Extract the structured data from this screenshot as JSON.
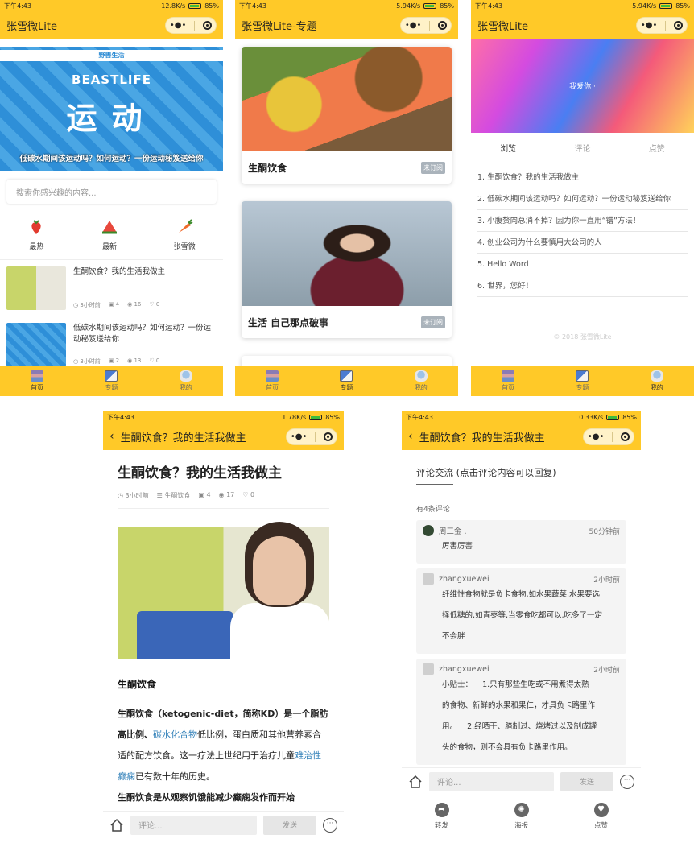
{
  "status": {
    "p1": {
      "time": "下午4:43",
      "speed": "12.8K/s",
      "battery": "85%"
    },
    "p2": {
      "time": "下午4:43",
      "speed": "5.94K/s",
      "battery": "85%"
    },
    "p3": {
      "time": "下午4:43",
      "speed": "5.94K/s",
      "battery": "85%"
    },
    "p4": {
      "time": "下午4:43",
      "speed": "1.78K/s",
      "battery": "85%"
    },
    "p5": {
      "time": "下午4:43",
      "speed": "0.33K/s",
      "battery": "85%"
    }
  },
  "capsule": {
    "dots": "•●•"
  },
  "home": {
    "title": "张雪微Lite",
    "banner": {
      "tag": "野兽生活",
      "brand": "BEASTLIFE",
      "big": "运动",
      "caption": "低碳水期间该运动吗？如何运动？一份运动秘笈送给你"
    },
    "search_placeholder": "搜索你感兴趣的内容...",
    "categories": [
      {
        "label": "最热",
        "icon": "strawberry-icon"
      },
      {
        "label": "最新",
        "icon": "watermelon-icon"
      },
      {
        "label": "张雪微",
        "icon": "carrot-icon"
      }
    ],
    "posts": [
      {
        "title": "生酮饮食？我的生活我做主",
        "time": "3小时前",
        "comments": "4",
        "views": "16",
        "likes": "0"
      },
      {
        "title": "低碳水期间该运动吗？如何运动？一份运动秘笈送给你",
        "time": "3小时前",
        "comments": "2",
        "views": "13",
        "likes": "0"
      }
    ]
  },
  "tabbar": [
    {
      "label": "首页",
      "icon": "home-tab-icon"
    },
    {
      "label": "专题",
      "icon": "topic-tab-icon"
    },
    {
      "label": "我的",
      "icon": "mine-tab-icon"
    }
  ],
  "topics": {
    "title": "张雪微Lite-专题",
    "cards": [
      {
        "title": "生酮饮食",
        "badge": "未订阅"
      },
      {
        "title": "生活 自己那点破事",
        "badge": "未订阅"
      }
    ]
  },
  "mine": {
    "title": "张雪微Lite",
    "hero_text": "我爱你 ·",
    "tabs": [
      "浏览",
      "评论",
      "点赞"
    ],
    "list": [
      "1. 生酮饮食？我的生活我做主",
      "2. 低碳水期间该运动吗？如何运动？一份运动秘笈送给你",
      "3. 小腹赘肉总消不掉？因为你一直用“错”方法！",
      "4. 创业公司为什么要慎用大公司的人",
      "5. Hello Word",
      "6. 世界，您好！"
    ],
    "copyright": "© 2018 张雪微Lite"
  },
  "article": {
    "nav_title": "生酮饮食？我的生活我做主",
    "title": "生酮饮食？我的生活我做主",
    "meta": {
      "time": "3小时前",
      "category": "生酮饮食",
      "comments": "4",
      "views": "17",
      "likes": "0"
    },
    "heading": "生酮饮食",
    "p1_a": "生酮饮食（ketogenic-diet，简称KD）是一个脂肪高比例、",
    "p1_link1": "碳水化合物",
    "p1_b": "低比例，蛋白质和其他营养素合适的配方饮食。这一疗法上世纪用于治疗儿童",
    "p1_link2": "难治性癫痫",
    "p1_c": "已有数十年的历史。",
    "p2": "生酮饮食是从观察饥饿能减少癫痫发作而开始",
    "comment_placeholder": "评论...",
    "send": "发送"
  },
  "comments": {
    "nav_title": "生酮饮食？我的生活我做主",
    "heading": "评论交流 (点击评论内容可以回复)",
    "count": "有4条评论",
    "items": [
      {
        "user": "周三金 .",
        "time": "50分钟前",
        "lines": [
          "厉害厉害"
        ]
      },
      {
        "user": "zhangxuewei",
        "time": "2小时前",
        "lines": [
          "纤维性食物就是负卡食物,如水果蔬菜,水果要选",
          "择低糖的,如青枣等,当零食吃都可以,吃多了一定",
          "不会胖"
        ]
      },
      {
        "user": "zhangxuewei",
        "time": "2小时前",
        "lines": [
          "小贴士：    1.只有那些生吃或不用煮得太熟",
          "的食物、新鲜的水果和果仁，才具负卡路里作",
          "用。    2.经晒干、腌制过、烧烤过以及制成罐",
          "头的食物，则不会具有负卡路里作用。"
        ]
      }
    ],
    "comment_placeholder": "评论...",
    "send": "发送",
    "actions": [
      {
        "label": "转发",
        "icon": "share-icon"
      },
      {
        "label": "海报",
        "icon": "poster-icon"
      },
      {
        "label": "点赞",
        "icon": "heart-icon"
      }
    ]
  },
  "colors": {
    "brand": "#ffc928",
    "link": "#2f7fb8"
  }
}
